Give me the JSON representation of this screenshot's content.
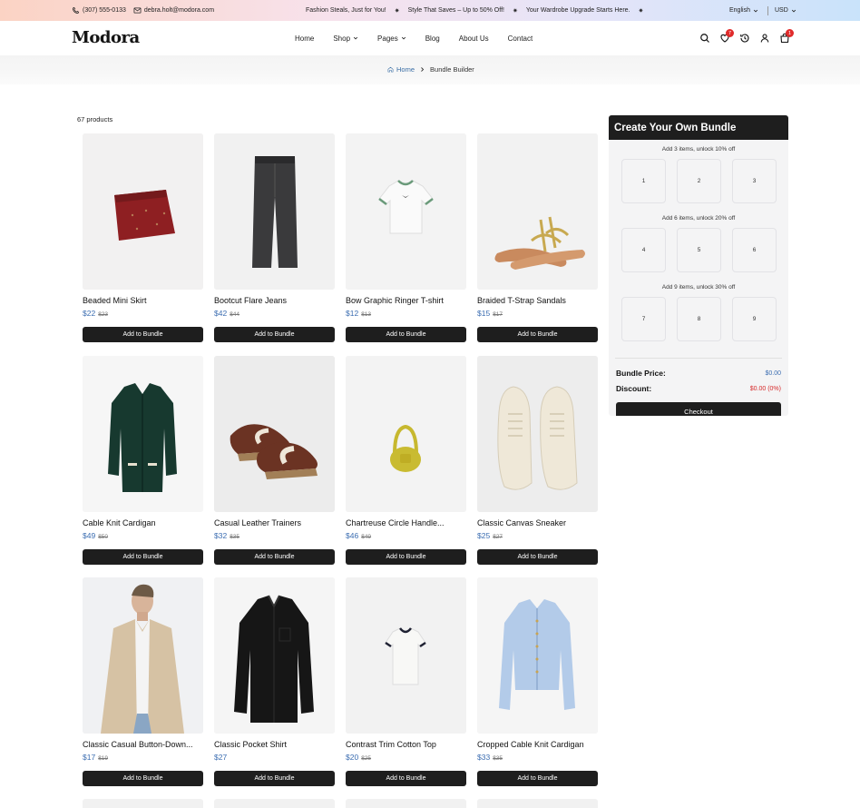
{
  "topbar": {
    "phone": "(307) 555-0133",
    "email": "debra.holt@modora.com",
    "promos": [
      "Fashion Steals, Just for You!",
      "Style That Saves – Up to 50% Off!",
      "Your Wardrobe Upgrade Starts Here."
    ],
    "promo_separator": "✷",
    "language": "English",
    "currency": "USD"
  },
  "header": {
    "logo": "Modora",
    "nav": [
      {
        "label": "Home",
        "dropdown": false
      },
      {
        "label": "Shop",
        "dropdown": true
      },
      {
        "label": "Pages",
        "dropdown": true
      },
      {
        "label": "Blog",
        "dropdown": false
      },
      {
        "label": "About Us",
        "dropdown": false
      },
      {
        "label": "Contact",
        "dropdown": false
      }
    ],
    "wishlist_count": "7",
    "cart_count": "1",
    "icons": [
      "search-icon",
      "heart-icon",
      "history-icon",
      "user-icon",
      "bag-icon"
    ]
  },
  "breadcrumb": {
    "home": "Home",
    "current": "Bundle Builder"
  },
  "listing": {
    "count": "67 products",
    "add_label": "Add to Bundle",
    "products": [
      {
        "name": "Beaded Mini Skirt",
        "price": "$22",
        "old_price": "$23",
        "art": "skirt"
      },
      {
        "name": "Bootcut Flare Jeans",
        "price": "$42",
        "old_price": "$44",
        "art": "jeans"
      },
      {
        "name": "Bow Graphic Ringer T-shirt",
        "price": "$12",
        "old_price": "$13",
        "art": "ringer"
      },
      {
        "name": "Braided T-Strap Sandals",
        "price": "$15",
        "old_price": "$17",
        "art": "sandals"
      },
      {
        "name": "Cable Knit Cardigan",
        "price": "$49",
        "old_price": "$50",
        "art": "cardigan"
      },
      {
        "name": "Casual Leather Trainers",
        "price": "$32",
        "old_price": "$35",
        "art": "trainers"
      },
      {
        "name": "Chartreuse Circle Handle...",
        "price": "$46",
        "old_price": "$49",
        "art": "bag"
      },
      {
        "name": "Classic Canvas Sneaker",
        "price": "$25",
        "old_price": "$27",
        "art": "sneakers"
      },
      {
        "name": "Classic Casual Button-Down...",
        "price": "$17",
        "old_price": "$19",
        "art": "model"
      },
      {
        "name": "Classic Pocket Shirt",
        "price": "$27",
        "old_price": "",
        "art": "shirt"
      },
      {
        "name": "Contrast Trim Cotton Top",
        "price": "$20",
        "old_price": "$25",
        "art": "tee"
      },
      {
        "name": "Cropped Cable Knit Cardigan",
        "price": "$33",
        "old_price": "$35",
        "art": "bluecardigan"
      }
    ]
  },
  "bundle": {
    "title": "Create Your Own Bundle",
    "tiers": [
      {
        "label": "Add 3 items, unlock 10% off",
        "slots": [
          "1",
          "2",
          "3"
        ]
      },
      {
        "label": "Add 6 items, unlock 20% off",
        "slots": [
          "4",
          "5",
          "6"
        ]
      },
      {
        "label": "Add 9 items, unlock 30% off",
        "slots": [
          "7",
          "8",
          "9"
        ]
      }
    ],
    "price_label": "Bundle Price:",
    "price_value": "$0.00",
    "discount_label": "Discount:",
    "discount_value": "$0.00 (0%)",
    "checkout_label": "Checkout"
  }
}
